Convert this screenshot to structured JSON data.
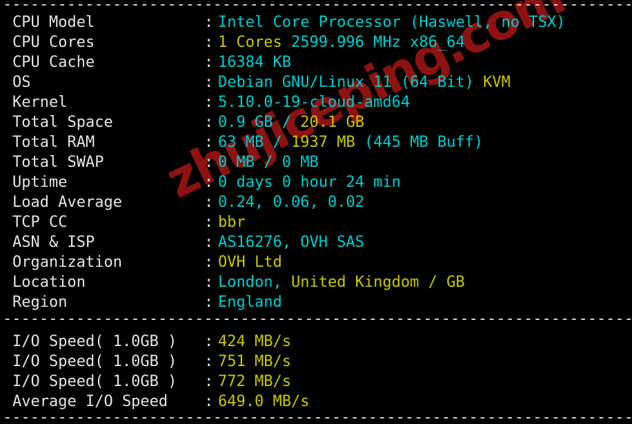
{
  "terminal": {
    "background_color": "#000000",
    "label_color": "#e6e6e6",
    "cyan_color": "#00cdcd",
    "yellow_color": "#c8c800",
    "separator": "-------------------------------------------------------------------------"
  },
  "watermark": {
    "text": "zhujiceping.com",
    "color": "#8f1212"
  },
  "system_info": {
    "separator_top": "-------------------------------------------------------------------------",
    "separator_middle": "-------------------------------------------------------------------------",
    "separator_bottom": "-------------------------------------------------------------------------",
    "colon": ":",
    "rows": [
      {
        "label": "CPU Model",
        "value": "Intel Core Processor (Haswell, no TSX)",
        "segments": [
          {
            "text": "Intel Core Processor (Haswell, no TSX)",
            "color": "cyan"
          }
        ]
      },
      {
        "label": "CPU Cores",
        "value": "1 Cores 2599.996 MHz x86_64",
        "segments": [
          {
            "text": "1 Cores",
            "color": "yellow"
          },
          {
            "text": " 2599.996 MHz x86_64",
            "color": "cyan"
          }
        ]
      },
      {
        "label": "CPU Cache",
        "value": "16384 KB",
        "segments": [
          {
            "text": "16384 KB",
            "color": "cyan"
          }
        ]
      },
      {
        "label": "OS",
        "value": "Debian GNU/Linux 11 (64 Bit) KVM",
        "segments": [
          {
            "text": "Debian GNU/Linux 11 (64 Bit) ",
            "color": "cyan"
          },
          {
            "text": "KVM",
            "color": "yellow"
          }
        ]
      },
      {
        "label": "Kernel",
        "value": "5.10.0-19-cloud-amd64",
        "segments": [
          {
            "text": "5.10.0-19-cloud-amd64",
            "color": "cyan"
          }
        ]
      },
      {
        "label": "Total Space",
        "value": "0.9 GB / 20.1 GB",
        "segments": [
          {
            "text": "0.9 GB ",
            "color": "cyan"
          },
          {
            "text": "/ ",
            "color": "cyan"
          },
          {
            "text": "20.1 GB",
            "color": "yellow"
          }
        ]
      },
      {
        "label": "Total RAM",
        "value": "63 MB / 1937 MB (445 MB Buff)",
        "segments": [
          {
            "text": "63 MB / ",
            "color": "cyan"
          },
          {
            "text": "1937 MB ",
            "color": "yellow"
          },
          {
            "text": "(445 MB Buff)",
            "color": "cyan"
          }
        ]
      },
      {
        "label": "Total SWAP",
        "value": "0 MB / 0 MB",
        "segments": [
          {
            "text": "0 MB / 0 MB",
            "color": "cyan"
          }
        ]
      },
      {
        "label": "Uptime",
        "value": "0 days 0 hour 24 min",
        "segments": [
          {
            "text": "0 days 0 hour 24 min",
            "color": "cyan"
          }
        ]
      },
      {
        "label": "Load Average",
        "value": "0.24, 0.06, 0.02",
        "segments": [
          {
            "text": "0.24, 0.06, 0.02",
            "color": "cyan"
          }
        ]
      },
      {
        "label": "TCP CC",
        "value": "bbr",
        "segments": [
          {
            "text": "bbr",
            "color": "yellow"
          }
        ]
      },
      {
        "label": "ASN & ISP",
        "value": "AS16276, OVH SAS",
        "segments": [
          {
            "text": "AS16276, OVH SAS",
            "color": "cyan"
          }
        ]
      },
      {
        "label": "Organization",
        "value": "OVH Ltd",
        "segments": [
          {
            "text": "OVH Ltd",
            "color": "yellow"
          }
        ]
      },
      {
        "label": "Location",
        "value": "London, United Kingdom / GB",
        "segments": [
          {
            "text": "London, ",
            "color": "cyan"
          },
          {
            "text": "United Kingdom / GB",
            "color": "yellow"
          }
        ]
      },
      {
        "label": "Region",
        "value": "England",
        "segments": [
          {
            "text": "England",
            "color": "cyan"
          }
        ]
      }
    ]
  },
  "io_test": {
    "rows": [
      {
        "label": "I/O Speed( 1.0GB )",
        "value": "424 MB/s",
        "segments": [
          {
            "text": "424 MB/s",
            "color": "yellow"
          }
        ]
      },
      {
        "label": "I/O Speed( 1.0GB )",
        "value": "751 MB/s",
        "segments": [
          {
            "text": "751 MB/s",
            "color": "yellow"
          }
        ]
      },
      {
        "label": "I/O Speed( 1.0GB )",
        "value": "772 MB/s",
        "segments": [
          {
            "text": "772 MB/s",
            "color": "yellow"
          }
        ]
      },
      {
        "label": "Average I/O Speed",
        "value": "649.0 MB/s",
        "segments": [
          {
            "text": "649.0 MB/s",
            "color": "yellow"
          }
        ]
      }
    ]
  }
}
